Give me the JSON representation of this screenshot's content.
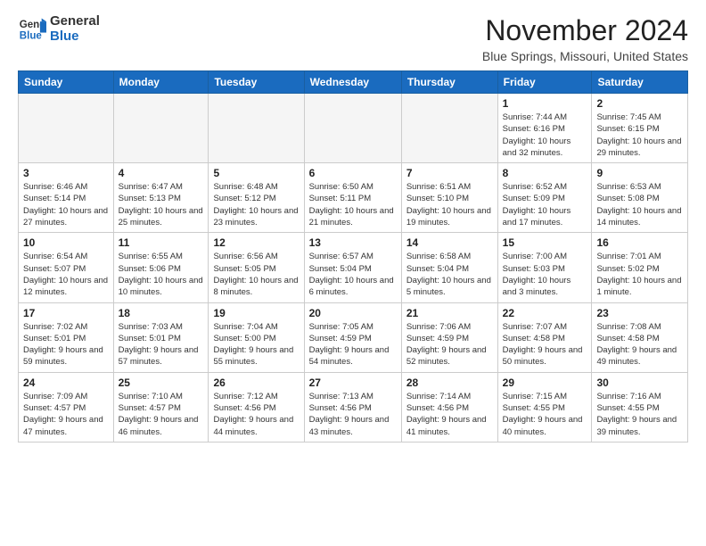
{
  "header": {
    "logo_general": "General",
    "logo_blue": "Blue",
    "month_title": "November 2024",
    "location": "Blue Springs, Missouri, United States"
  },
  "days_of_week": [
    "Sunday",
    "Monday",
    "Tuesday",
    "Wednesday",
    "Thursday",
    "Friday",
    "Saturday"
  ],
  "weeks": [
    [
      {
        "day": "",
        "info": ""
      },
      {
        "day": "",
        "info": ""
      },
      {
        "day": "",
        "info": ""
      },
      {
        "day": "",
        "info": ""
      },
      {
        "day": "",
        "info": ""
      },
      {
        "day": "1",
        "info": "Sunrise: 7:44 AM\nSunset: 6:16 PM\nDaylight: 10 hours and 32 minutes."
      },
      {
        "day": "2",
        "info": "Sunrise: 7:45 AM\nSunset: 6:15 PM\nDaylight: 10 hours and 29 minutes."
      }
    ],
    [
      {
        "day": "3",
        "info": "Sunrise: 6:46 AM\nSunset: 5:14 PM\nDaylight: 10 hours and 27 minutes."
      },
      {
        "day": "4",
        "info": "Sunrise: 6:47 AM\nSunset: 5:13 PM\nDaylight: 10 hours and 25 minutes."
      },
      {
        "day": "5",
        "info": "Sunrise: 6:48 AM\nSunset: 5:12 PM\nDaylight: 10 hours and 23 minutes."
      },
      {
        "day": "6",
        "info": "Sunrise: 6:50 AM\nSunset: 5:11 PM\nDaylight: 10 hours and 21 minutes."
      },
      {
        "day": "7",
        "info": "Sunrise: 6:51 AM\nSunset: 5:10 PM\nDaylight: 10 hours and 19 minutes."
      },
      {
        "day": "8",
        "info": "Sunrise: 6:52 AM\nSunset: 5:09 PM\nDaylight: 10 hours and 17 minutes."
      },
      {
        "day": "9",
        "info": "Sunrise: 6:53 AM\nSunset: 5:08 PM\nDaylight: 10 hours and 14 minutes."
      }
    ],
    [
      {
        "day": "10",
        "info": "Sunrise: 6:54 AM\nSunset: 5:07 PM\nDaylight: 10 hours and 12 minutes."
      },
      {
        "day": "11",
        "info": "Sunrise: 6:55 AM\nSunset: 5:06 PM\nDaylight: 10 hours and 10 minutes."
      },
      {
        "day": "12",
        "info": "Sunrise: 6:56 AM\nSunset: 5:05 PM\nDaylight: 10 hours and 8 minutes."
      },
      {
        "day": "13",
        "info": "Sunrise: 6:57 AM\nSunset: 5:04 PM\nDaylight: 10 hours and 6 minutes."
      },
      {
        "day": "14",
        "info": "Sunrise: 6:58 AM\nSunset: 5:04 PM\nDaylight: 10 hours and 5 minutes."
      },
      {
        "day": "15",
        "info": "Sunrise: 7:00 AM\nSunset: 5:03 PM\nDaylight: 10 hours and 3 minutes."
      },
      {
        "day": "16",
        "info": "Sunrise: 7:01 AM\nSunset: 5:02 PM\nDaylight: 10 hours and 1 minute."
      }
    ],
    [
      {
        "day": "17",
        "info": "Sunrise: 7:02 AM\nSunset: 5:01 PM\nDaylight: 9 hours and 59 minutes."
      },
      {
        "day": "18",
        "info": "Sunrise: 7:03 AM\nSunset: 5:01 PM\nDaylight: 9 hours and 57 minutes."
      },
      {
        "day": "19",
        "info": "Sunrise: 7:04 AM\nSunset: 5:00 PM\nDaylight: 9 hours and 55 minutes."
      },
      {
        "day": "20",
        "info": "Sunrise: 7:05 AM\nSunset: 4:59 PM\nDaylight: 9 hours and 54 minutes."
      },
      {
        "day": "21",
        "info": "Sunrise: 7:06 AM\nSunset: 4:59 PM\nDaylight: 9 hours and 52 minutes."
      },
      {
        "day": "22",
        "info": "Sunrise: 7:07 AM\nSunset: 4:58 PM\nDaylight: 9 hours and 50 minutes."
      },
      {
        "day": "23",
        "info": "Sunrise: 7:08 AM\nSunset: 4:58 PM\nDaylight: 9 hours and 49 minutes."
      }
    ],
    [
      {
        "day": "24",
        "info": "Sunrise: 7:09 AM\nSunset: 4:57 PM\nDaylight: 9 hours and 47 minutes."
      },
      {
        "day": "25",
        "info": "Sunrise: 7:10 AM\nSunset: 4:57 PM\nDaylight: 9 hours and 46 minutes."
      },
      {
        "day": "26",
        "info": "Sunrise: 7:12 AM\nSunset: 4:56 PM\nDaylight: 9 hours and 44 minutes."
      },
      {
        "day": "27",
        "info": "Sunrise: 7:13 AM\nSunset: 4:56 PM\nDaylight: 9 hours and 43 minutes."
      },
      {
        "day": "28",
        "info": "Sunrise: 7:14 AM\nSunset: 4:56 PM\nDaylight: 9 hours and 41 minutes."
      },
      {
        "day": "29",
        "info": "Sunrise: 7:15 AM\nSunset: 4:55 PM\nDaylight: 9 hours and 40 minutes."
      },
      {
        "day": "30",
        "info": "Sunrise: 7:16 AM\nSunset: 4:55 PM\nDaylight: 9 hours and 39 minutes."
      }
    ]
  ]
}
